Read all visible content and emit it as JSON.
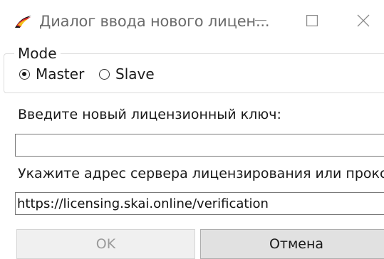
{
  "window": {
    "title": "Диалог ввода нового лицен...",
    "icon": "app-logo-icon",
    "controls": [
      "minimize-icon",
      "maximize-icon",
      "close-icon"
    ]
  },
  "mode": {
    "label": "Mode",
    "options": [
      {
        "label": "Master",
        "checked": true
      },
      {
        "label": "Slave",
        "checked": false
      }
    ]
  },
  "license_key": {
    "label": "Введите новый лицензионный ключ:",
    "value": ""
  },
  "server": {
    "label": "Укажите адрес сервера лицензирования или прокси:",
    "value": "https://licensing.skai.online/verification"
  },
  "buttons": {
    "ok_label": "OK",
    "ok_enabled": false,
    "cancel_label": "Отмена"
  },
  "colors": {
    "logo_red": "#d9282f",
    "logo_yellow": "#f4c21a",
    "logo_black": "#1a1a1a"
  }
}
